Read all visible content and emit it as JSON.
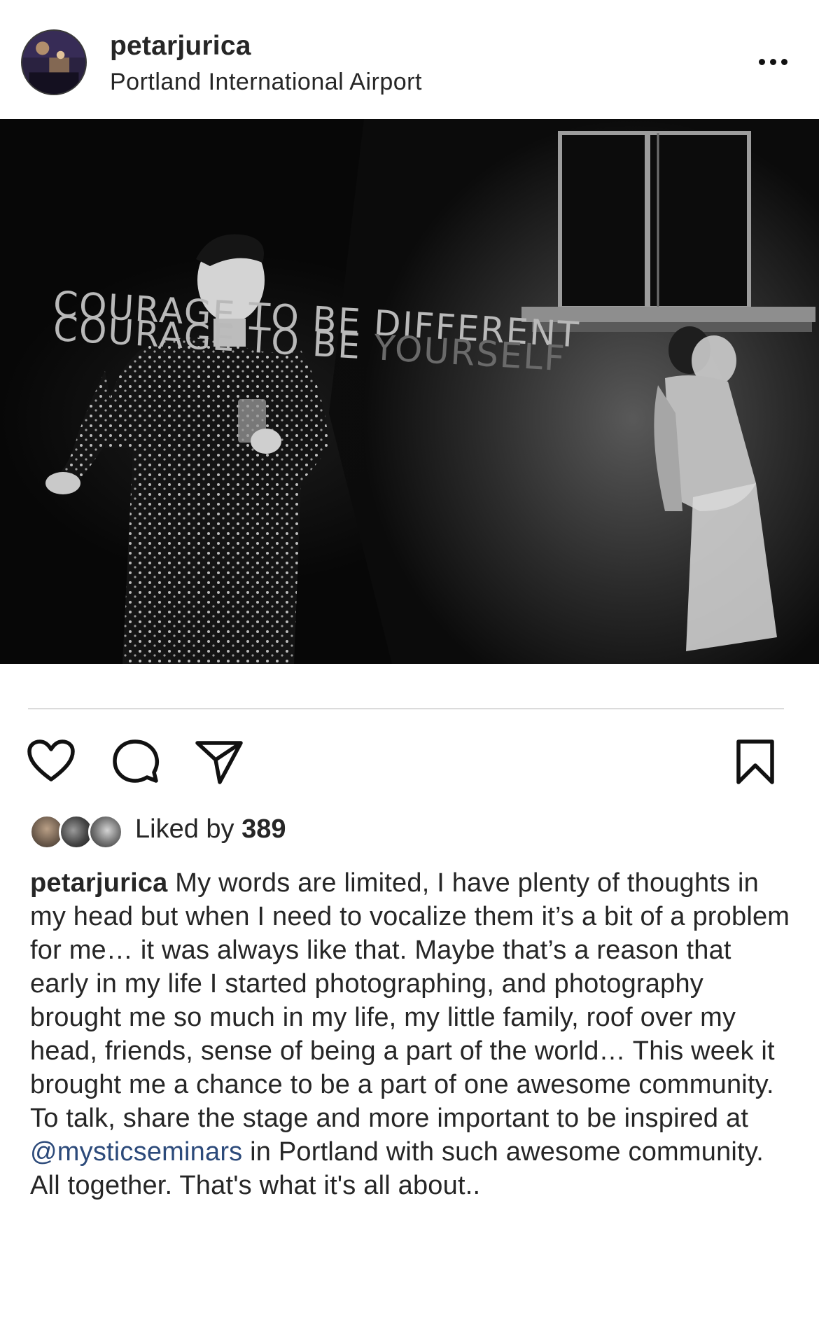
{
  "post": {
    "username": "petarjurica",
    "location": "Portland International Airport",
    "image": {
      "overlay_line_1": "COURAGE TO BE DIFFERENT",
      "overlay_line_2_start": "COURAGE TO BE ",
      "overlay_line_2_end": "YOURSELF"
    },
    "likes": {
      "prefix": "Liked by ",
      "count": "389"
    },
    "caption": {
      "username": "petarjurica",
      "text_before_mention": " My words are limited, I have plenty of thoughts in my head but when I need to vocalize them it’s a bit of a problem for me… it was always like that. Maybe that’s a reason that early in my life I started photographing, and photography brought me so much in my life, my little family, roof over my head, friends, sense of being a part of the world… This week it brought me a chance to be a part of one awesome community. To talk,  share the stage and more important to be inspired at ",
      "mention": "@mysticseminars",
      "text_after_mention": " in Portland with such awesome community. All together. That's what it's all about.."
    }
  },
  "icons": {
    "avatar": "profile-avatar",
    "more": "more-options-icon",
    "like": "heart-icon",
    "comment": "comment-bubble-icon",
    "share": "paper-plane-icon",
    "save": "bookmark-icon"
  },
  "colors": {
    "text": "#262626",
    "mention": "#2c4a7a",
    "divider": "#dbdbdb"
  }
}
